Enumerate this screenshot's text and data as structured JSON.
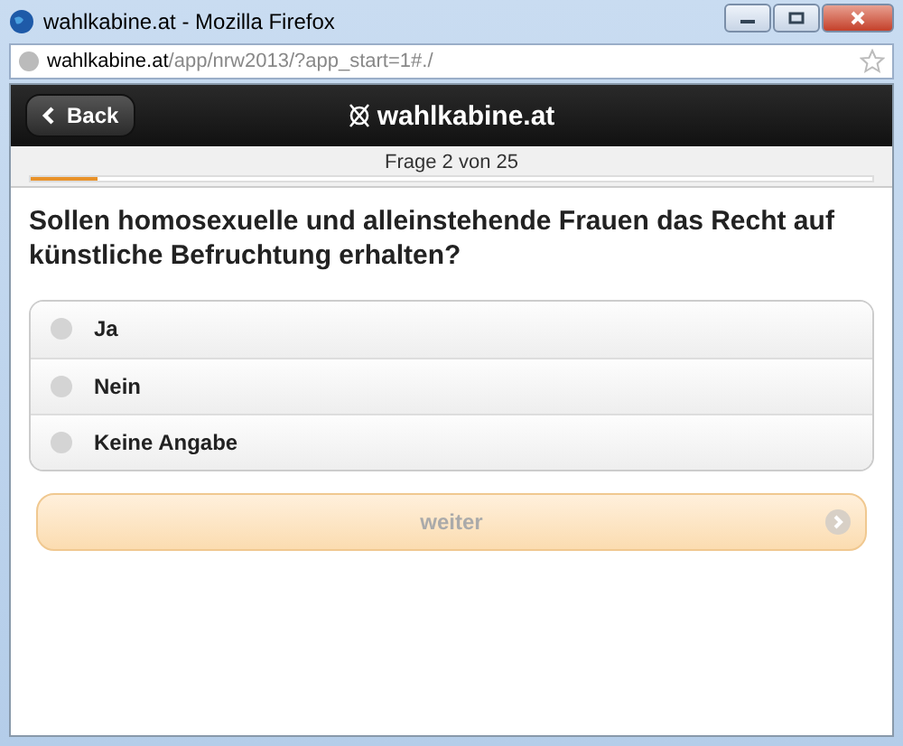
{
  "window": {
    "title": "wahlkabine.at - Mozilla Firefox"
  },
  "address_bar": {
    "host": "wahlkabine.at",
    "path": "/app/nrw2013/?app_start=1#./"
  },
  "header": {
    "back_button": "Back",
    "title": "wahlkabine.at"
  },
  "progress": {
    "label": "Frage 2 von 25",
    "level": 0.08
  },
  "question": "Sollen homosexuelle und alleinstehende Frauen das Recht auf künstliche Befruchtung erhalten?",
  "options": [
    {
      "label": "Ja",
      "selected": false
    },
    {
      "label": "Nein",
      "selected": false
    },
    {
      "label": "Keine Angabe",
      "selected": false
    }
  ],
  "next_button": {
    "label": "weiter",
    "disabled": true
  }
}
